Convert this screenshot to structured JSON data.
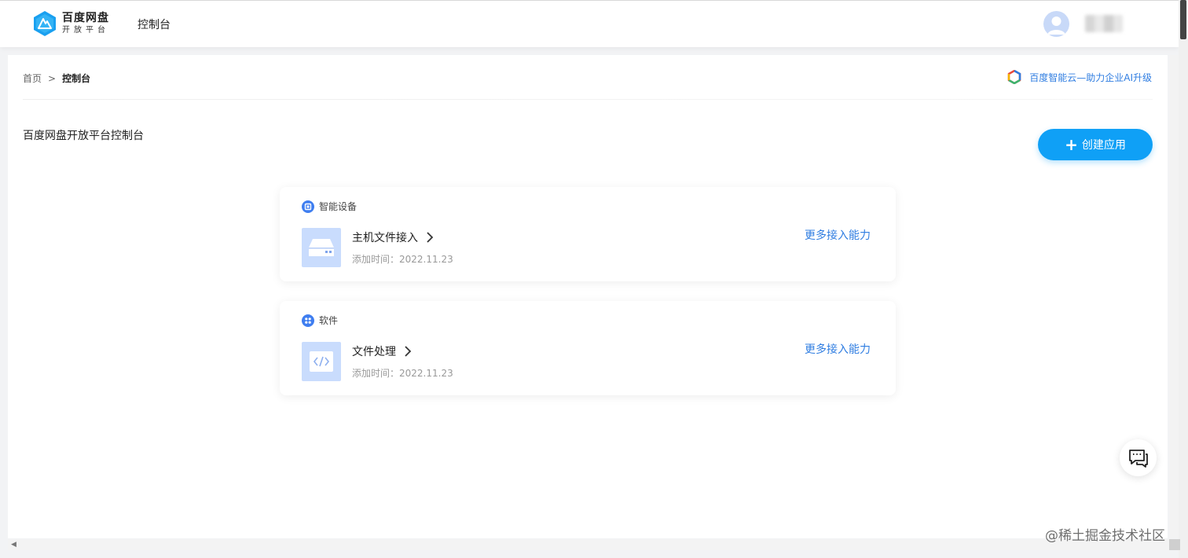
{
  "header": {
    "logo_title": "百度网盘",
    "logo_sub": "开放平台",
    "nav_label": "控制台"
  },
  "breadcrumb": {
    "home": "首页",
    "separator": ">",
    "current": "控制台"
  },
  "cloud_link": "百度智能云—助力企业AI升级",
  "page_title": "百度网盘开放平台控制台",
  "create_button": {
    "plus": "+",
    "label": "创建应用"
  },
  "cards": [
    {
      "category": "智能设备",
      "category_icon": "device-icon",
      "app_icon": "server-icon",
      "app_name": "主机文件接入",
      "time": "添加时间：2022.11.23",
      "more_label": "更多接入能力"
    },
    {
      "category": "软件",
      "category_icon": "apps-grid-icon",
      "app_icon": "code-icon",
      "app_name": "文件处理",
      "time": "添加时间：2022.11.23",
      "more_label": "更多接入能力"
    }
  ],
  "watermark": "@稀土掘金技术社区",
  "colors": {
    "accent": "#0fa0f6",
    "link": "#2f7de1",
    "app_icon_bg": "#c9dcfd",
    "category_icon": "#3f7ef0"
  }
}
